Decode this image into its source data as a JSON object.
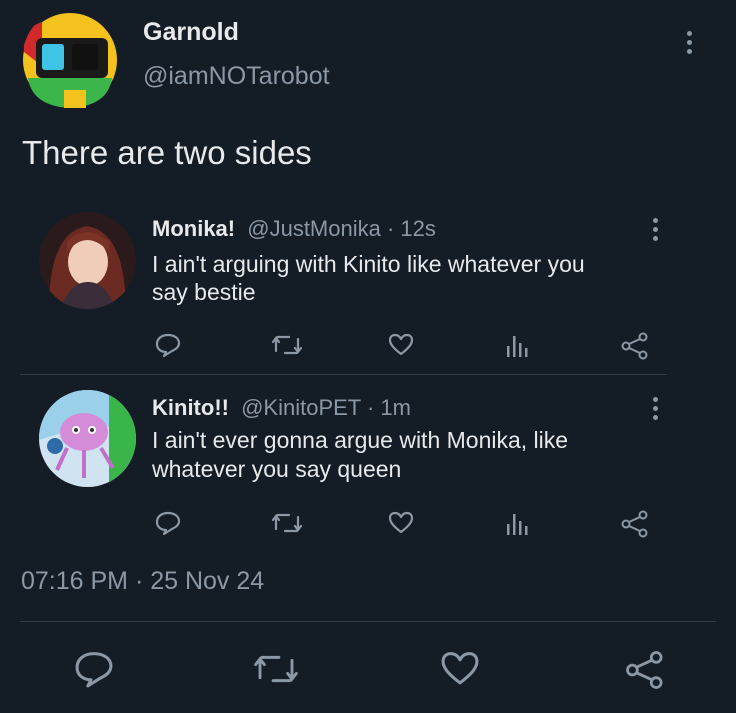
{
  "tweet": {
    "author_name": "Garnold",
    "author_handle": "@iamNOTarobot",
    "text": "There are two sides",
    "timestamp": "07:16 PM · 25 Nov 24"
  },
  "replies": [
    {
      "name": "Monika!",
      "meta": "@JustMonika · 12s",
      "text_line1": "I ain't arguing with Kinito like whatever you",
      "text_line2": "say bestie"
    },
    {
      "name": "Kinito!!",
      "meta": "@KinitoPET · 1m",
      "text_line1": "I ain't ever gonna argue with Monika, like",
      "text_line2": "whatever you say queen"
    }
  ],
  "icons": {
    "reply": "speech-bubble-icon",
    "retweet": "retweet-icon",
    "like": "heart-icon",
    "views": "bar-chart-icon",
    "share": "share-icon",
    "more": "more-vertical-icon"
  },
  "colors": {
    "background": "#141c26",
    "text": "#e7e9ea",
    "muted": "#8b98a5",
    "divider": "#2f3a46"
  }
}
